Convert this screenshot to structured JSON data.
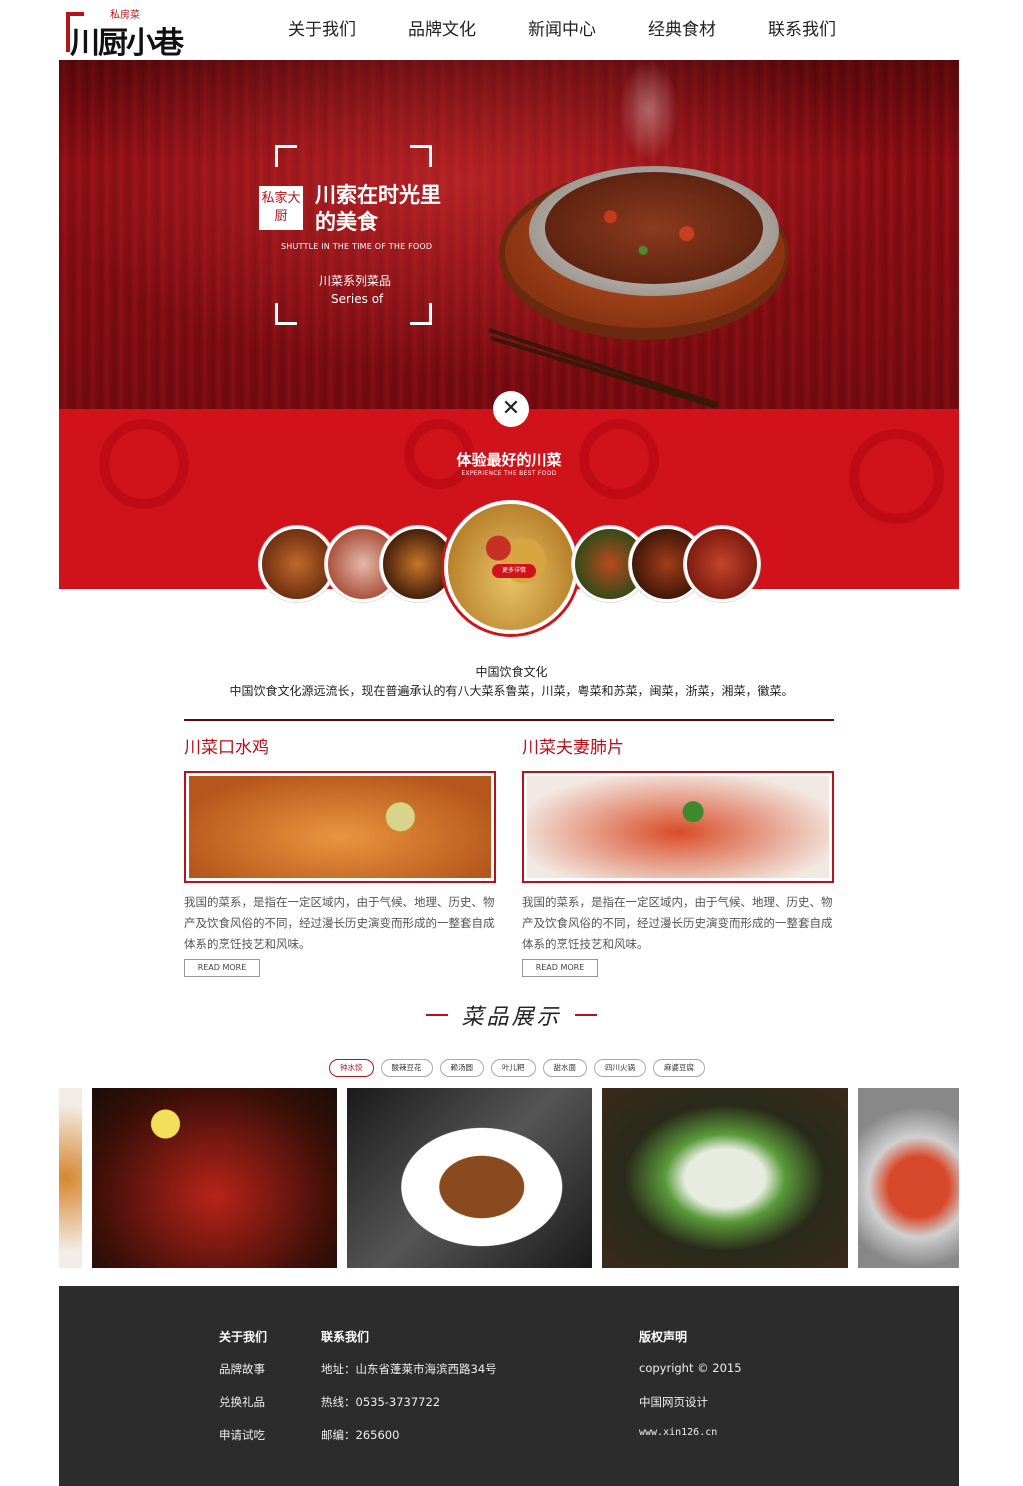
{
  "header": {
    "logo_text": "川厨小巷",
    "logo_seal": "私房菜",
    "nav": [
      "关于我们",
      "品牌文化",
      "新闻中心",
      "经典食材",
      "联系我们"
    ]
  },
  "banner": {
    "seal_text": "私家大厨",
    "title_line1": "川索在时光里",
    "title_line2": "的美食",
    "subtitle_en": "SHUTTLE IN THE TIME OF THE FOOD",
    "series_cn": "川菜系列菜品",
    "series_en": "Series of"
  },
  "red_section": {
    "close_symbol": "✕",
    "title": "体验最好的川菜",
    "subtitle_en": "EXPERIENCE THE BEST FOOD",
    "more_button": "更多详情"
  },
  "culture": {
    "title": "中国饮食文化",
    "description": "中国饮食文化源远流长，现在普遍承认的有八大菜系鲁菜，川菜，粤菜和苏菜，闽菜，浙菜，湘菜，徽菜。"
  },
  "articles": [
    {
      "title": "川菜口水鸡",
      "text": "我国的菜系，是指在一定区域内，由于气候、地理、历史、物产及饮食风俗的不同，经过漫长历史演变而形成的一整套自成体系的烹饪技艺和风味。",
      "button": "READ MORE"
    },
    {
      "title": "川菜夫妻肺片",
      "text": "我国的菜系，是指在一定区域内，由于气候、地理、历史、物产及饮食风俗的不同，经过漫长历史演变而形成的一整套自成体系的烹饪技艺和风味。",
      "button": "READ MORE"
    }
  ],
  "showcase": {
    "title": "菜品展示",
    "tabs": [
      "钟水饺",
      "酸辣豆花",
      "赖汤圆",
      "叶儿粑",
      "甜水面",
      "四川火锅",
      "麻婆豆腐"
    ],
    "active_tab": 0
  },
  "footer": {
    "col1": {
      "heading": "关于我们",
      "items": [
        "品牌故事",
        "兑换礼品",
        "申请试吃"
      ]
    },
    "col2": {
      "heading": "联系我们",
      "items": [
        "地址：山东省蓬莱市海滨西路34号",
        "热线：0535-3737722",
        "邮编：265600"
      ]
    },
    "col3": {
      "heading": "版权声明",
      "items": [
        "copyright © 2015",
        "中国网页设计",
        "www.xin126.cn"
      ]
    }
  },
  "colors": {
    "brand_red": "#b5121b",
    "section_red": "#d0121a",
    "footer_bg": "#2c2c2c"
  }
}
